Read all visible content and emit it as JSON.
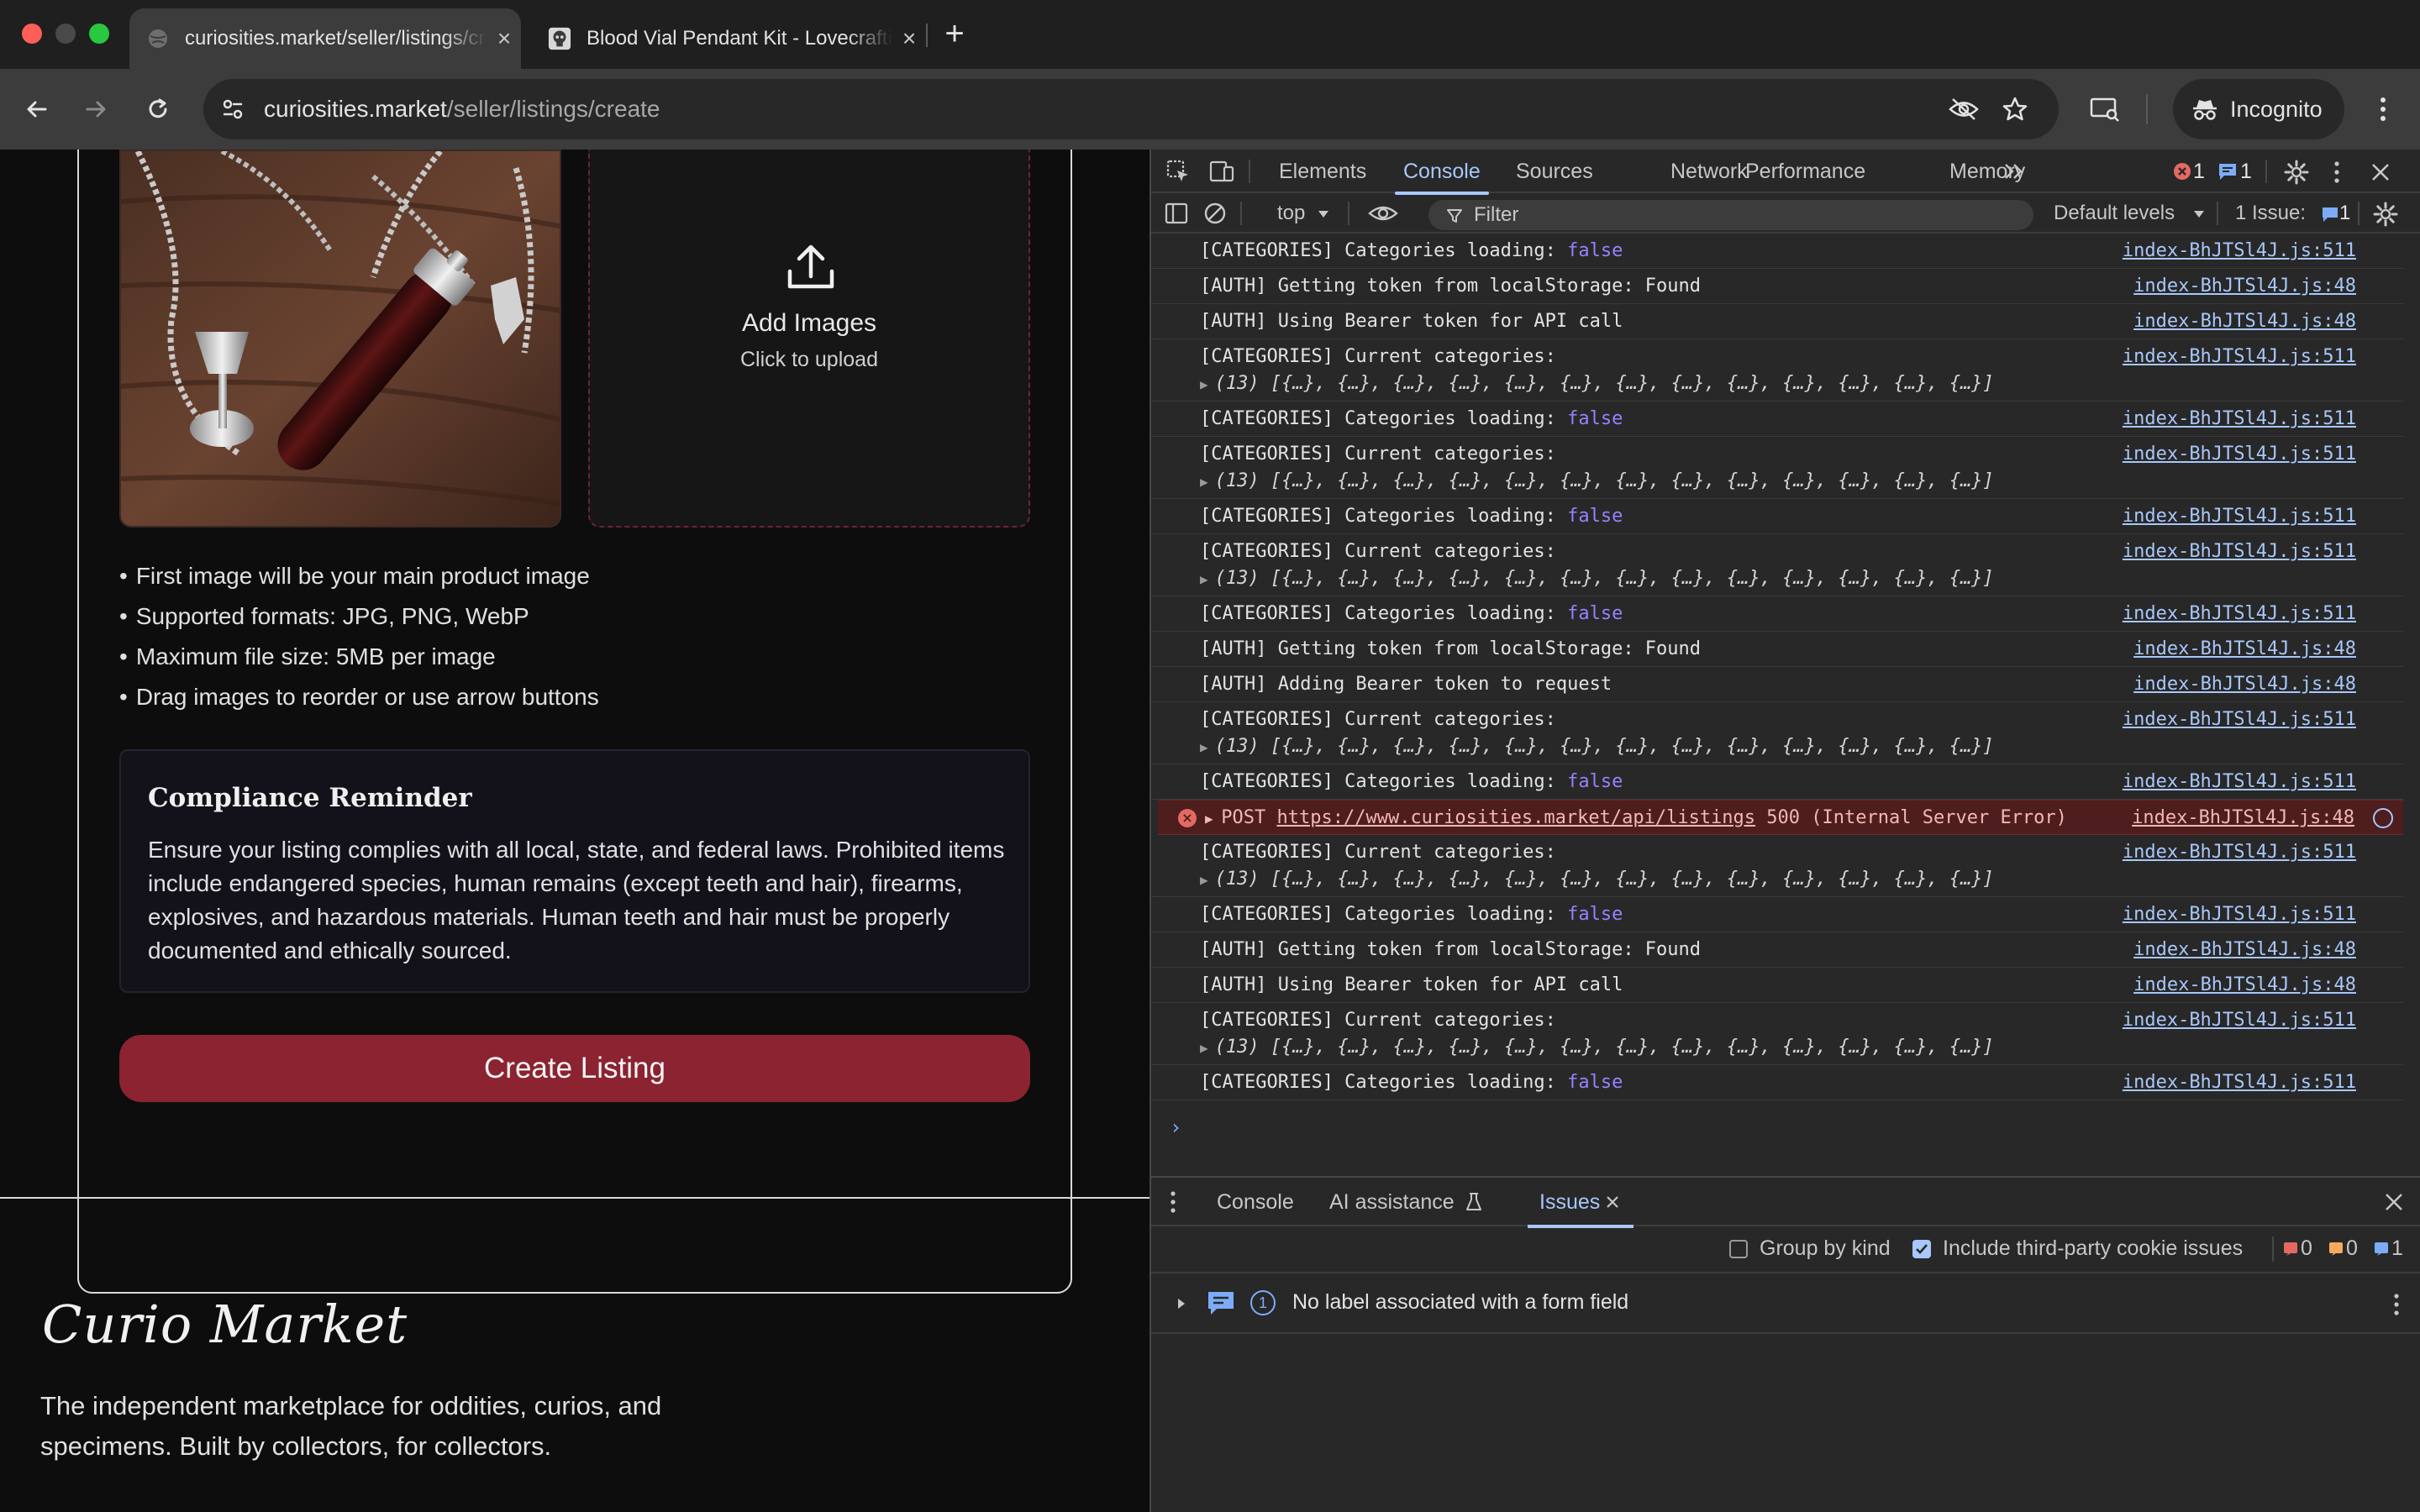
{
  "browser": {
    "tabs": [
      {
        "title": "curiosities.market/seller/listings/create",
        "active": true,
        "close": "×"
      },
      {
        "title": "Blood Vial Pendant Kit - Lovecraftian",
        "active": false,
        "close": "×"
      }
    ],
    "new_tab": "+",
    "url_host": "curiosities.market",
    "url_path": "/seller/listings/create",
    "incognito_label": "Incognito"
  },
  "page": {
    "dropzone": {
      "title": "Add Images",
      "subtitle": "Click to upload"
    },
    "tips": [
      "First image will be your main product image",
      "Supported formats: JPG, PNG, WebP",
      "Maximum file size: 5MB per image",
      "Drag images to reorder or use arrow buttons"
    ],
    "compliance": {
      "title": "Compliance Reminder",
      "body": "Ensure your listing complies with all local, state, and federal laws. Prohibited items include endangered species, human remains (except teeth and hair), firearms, explosives, and hazardous materials. Human teeth and hair must be properly documented and ethically sourced."
    },
    "create_button": "Create Listing",
    "footer": {
      "brand": "Curio Market",
      "tagline": "The independent marketplace for oddities, curios, and specimens. Built by collectors, for collectors."
    }
  },
  "devtools": {
    "tabs": [
      "Elements",
      "Console",
      "Sources",
      "Network",
      "Performance",
      "Memory"
    ],
    "active_tab": "Console",
    "error_count": "1",
    "info_count": "1",
    "context": "top",
    "filter_placeholder": "Filter",
    "levels": "Default levels",
    "issues_label": "1 Issue:",
    "issues_count": "1",
    "source_511": "index-BhJTSl4J.js:511",
    "source_48": "index-BhJTSl4J.js:48",
    "object_preview": "(13) [{…}, {…}, {…}, {…}, {…}, {…}, {…}, {…}, {…}, {…}, {…}, {…}, {…}]",
    "logs": [
      {
        "text": "[CATEGORIES] Categories loading: ",
        "kw": "false",
        "src": "511"
      },
      {
        "text": "[AUTH] Getting token from localStorage: Found",
        "src": "48"
      },
      {
        "text": "[AUTH] Using Bearer token for API call",
        "src": "48"
      },
      {
        "text": "[CATEGORIES] Current categories:",
        "obj": true,
        "src": "511"
      },
      {
        "text": "[CATEGORIES] Categories loading: ",
        "kw": "false",
        "src": "511"
      },
      {
        "text": "[CATEGORIES] Current categories:",
        "obj": true,
        "src": "511"
      },
      {
        "text": "[CATEGORIES] Categories loading: ",
        "kw": "false",
        "src": "511"
      },
      {
        "text": "[CATEGORIES] Current categories:",
        "obj": true,
        "src": "511"
      },
      {
        "text": "[CATEGORIES] Categories loading: ",
        "kw": "false",
        "src": "511"
      },
      {
        "text": "[AUTH] Getting token from localStorage: Found",
        "src": "48"
      },
      {
        "text": "[AUTH] Adding Bearer token to request",
        "src": "48"
      },
      {
        "text": "[CATEGORIES] Current categories:",
        "obj": true,
        "src": "511"
      },
      {
        "text": "[CATEGORIES] Categories loading: ",
        "kw": "false",
        "src": "511"
      },
      {
        "error": true,
        "method": "POST",
        "url": "https://www.curiosities.market/api/listings",
        "status": "500 (Internal Server Error)",
        "src": "48"
      },
      {
        "text": "[CATEGORIES] Current categories:",
        "obj": true,
        "src": "511"
      },
      {
        "text": "[CATEGORIES] Categories loading: ",
        "kw": "false",
        "src": "511"
      },
      {
        "text": "[AUTH] Getting token from localStorage: Found",
        "src": "48"
      },
      {
        "text": "[AUTH] Using Bearer token for API call",
        "src": "48"
      },
      {
        "text": "[CATEGORIES] Current categories:",
        "obj": true,
        "src": "511"
      },
      {
        "text": "[CATEGORIES] Categories loading: ",
        "kw": "false",
        "src": "511"
      }
    ],
    "drawer": {
      "tabs": [
        "Console",
        "AI assistance",
        "Issues"
      ],
      "active_tab": "Issues",
      "group_by_kind": "Group by kind",
      "include_third_party": "Include third-party cookie issues",
      "counts": {
        "errors": "0",
        "warnings": "0",
        "info": "1"
      },
      "issue": {
        "count": "1",
        "text": "No label associated with a form field"
      }
    }
  }
}
